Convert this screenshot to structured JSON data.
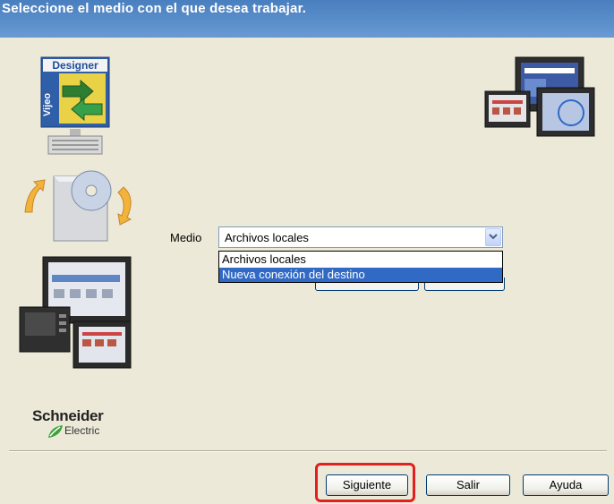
{
  "header": {
    "title": "Seleccione el medio con el que desea trabajar."
  },
  "branding": {
    "product_title": "Designer",
    "product_vertical": "Vijeo",
    "company": "Schneider",
    "company_sub": "Electric"
  },
  "form": {
    "medio_label": "Medio",
    "combo_value": "Archivos locales",
    "options": [
      "Archivos locales",
      "Nueva conexión del destino"
    ],
    "selected_index": 1
  },
  "buttons": {
    "next": "Siguiente",
    "exit": "Salir",
    "help": "Ayuda"
  },
  "colors": {
    "header": "#5B8FCB",
    "selection": "#316AC5",
    "highlight": "#E2201F",
    "background": "#ECE9D8"
  }
}
